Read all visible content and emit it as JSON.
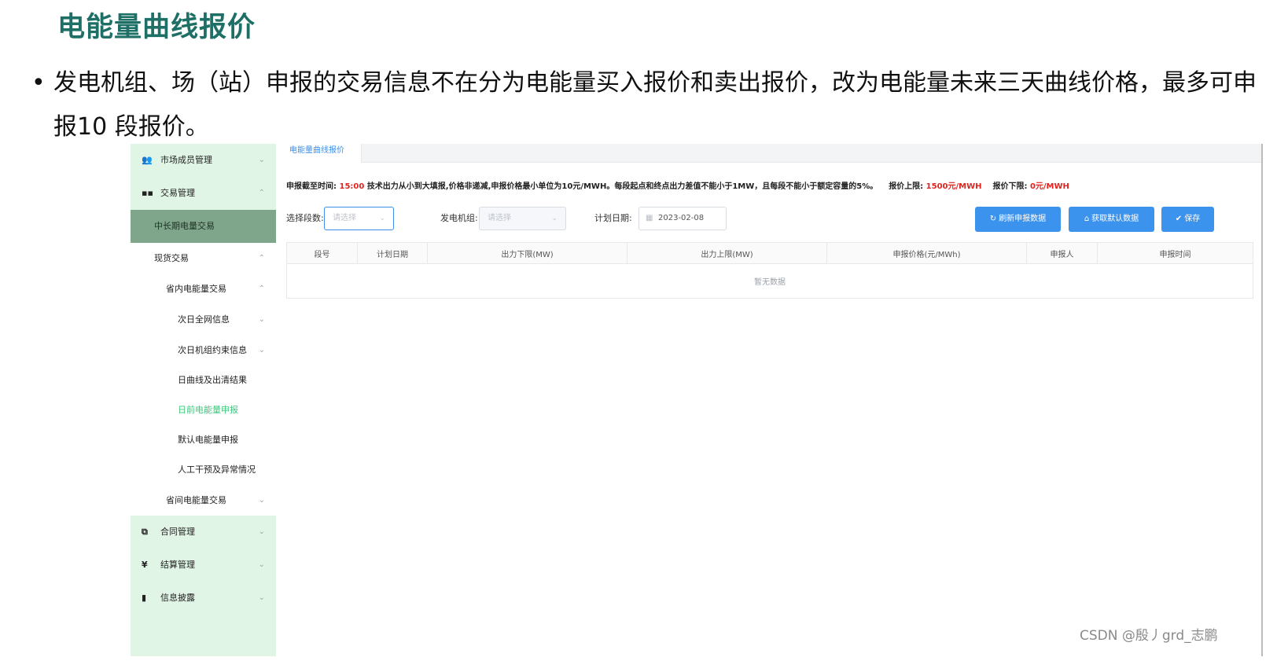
{
  "slide": {
    "title": "电能量曲线报价",
    "bullet_dot": "•",
    "bullet": "发电机组、场（站）申报的交易信息不在分为电能量买入报价和卖出报价，改为电能量未来三天曲线价格，最多可申报10 段报价。"
  },
  "sidebar": {
    "items": [
      {
        "label": "市场成员管理",
        "icon": "users-icon",
        "glyph": "👥"
      },
      {
        "label": "交易管理",
        "icon": "grid-icon",
        "glyph": "▪▪"
      },
      {
        "label": "中长期电量交易"
      },
      {
        "label": "现货交易"
      },
      {
        "label": "省内电能量交易"
      },
      {
        "label": "次日全网信息"
      },
      {
        "label": "次日机组约束信息"
      },
      {
        "label": "日曲线及出清结果"
      },
      {
        "label": "日前电能量申报"
      },
      {
        "label": "默认电能量申报"
      },
      {
        "label": "人工干预及异常情况"
      },
      {
        "label": "省间电能量交易"
      },
      {
        "label": "合同管理",
        "icon": "copy-icon",
        "glyph": "⧉"
      },
      {
        "label": "结算管理",
        "icon": "yen-icon",
        "glyph": "¥"
      },
      {
        "label": "信息披露",
        "icon": "document-icon",
        "glyph": "▮"
      }
    ],
    "chevron_down": "⌄",
    "chevron_up": "⌃"
  },
  "tab": {
    "label": "电能量曲线报价"
  },
  "notice": {
    "prefix": "申报截至时间:",
    "deadline": "15:00",
    "rules": "技术出力从小到大填报,价格非递减,申报价格最小单位为10元/MWH。每段起点和终点出力差值不能小于1MW，且每段不能小于额定容量的5%。",
    "upper_label": "报价上限:",
    "upper_value": "1500元/MWH",
    "lower_label": "报价下限:",
    "lower_value": "0元/MWH"
  },
  "form": {
    "segments_label": "选择段数:",
    "segments_placeholder": "请选择",
    "unit_label": "发电机组:",
    "unit_placeholder": "请选择",
    "date_label": "计划日期:",
    "date_value": "2023-02-08",
    "select_arrow": "⌄",
    "calendar_glyph": "▦"
  },
  "buttons": {
    "refresh": "刷新申报数据",
    "refresh_glyph": "↻",
    "fetch_default": "获取默认数据",
    "fetch_glyph": "⌂",
    "save": "保存",
    "save_glyph": "✔"
  },
  "table": {
    "headers": [
      "段号",
      "计划日期",
      "出力下限(MW)",
      "出力上限(MW)",
      "申报价格(元/MWh)",
      "申报人",
      "申报时间"
    ],
    "empty_text": "暂无数据"
  },
  "watermark": "CSDN @殷丿grd_志鹏",
  "colors": {
    "title_teal": "#1e6f66",
    "sidebar_bg": "#e1f5e6",
    "sidebar_active": "#7fa58a",
    "selected_green": "#3ec77c",
    "primary_blue": "#3b93ee",
    "alert_red": "#e0241f"
  }
}
